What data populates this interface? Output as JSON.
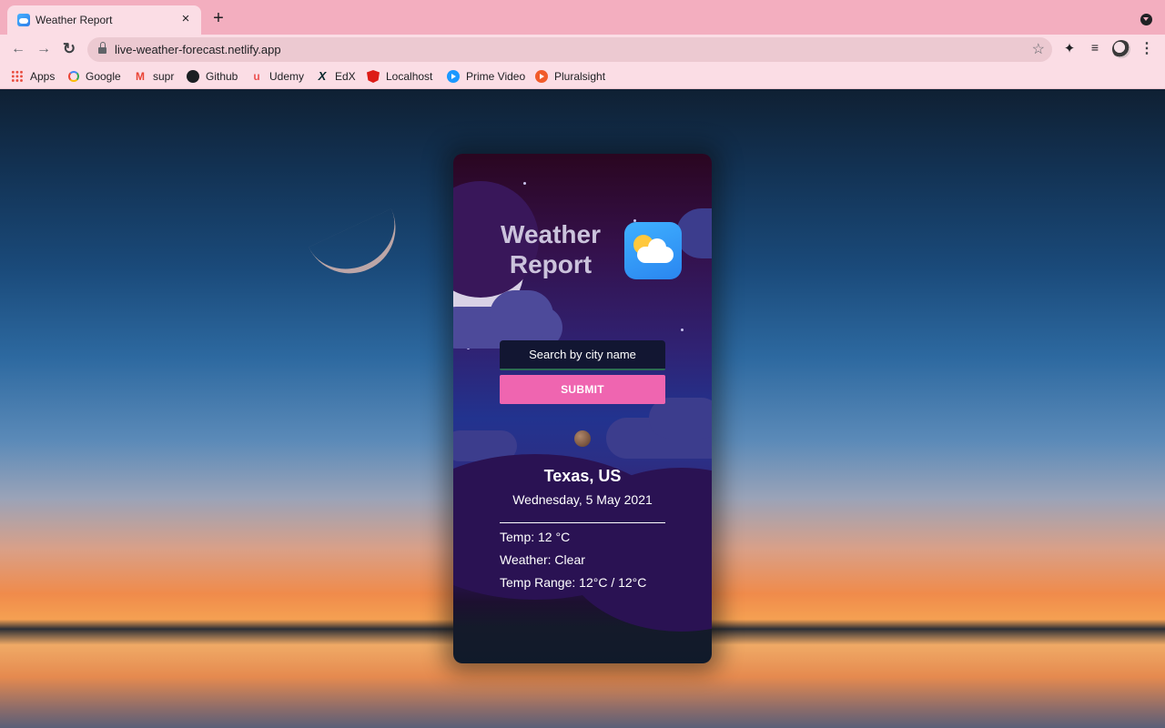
{
  "browser": {
    "tab_title": "Weather Report",
    "tab_close_glyph": "×",
    "new_tab_glyph": "+",
    "url": "live-weather-forecast.netlify.app",
    "nav": {
      "back_glyph": "←",
      "forward_glyph": "→",
      "reload_glyph": "↻"
    },
    "star_glyph": "☆",
    "menu_glyph": "⋮",
    "bookmarks": [
      {
        "label": "Apps",
        "icon": "apps-grid-icon"
      },
      {
        "label": "Google",
        "icon": "google-icon"
      },
      {
        "label": "supr",
        "icon": "gmail-icon"
      },
      {
        "label": "Github",
        "icon": "github-icon"
      },
      {
        "label": "Udemy",
        "icon": "udemy-icon"
      },
      {
        "label": "EdX",
        "icon": "edx-icon"
      },
      {
        "label": "Localhost",
        "icon": "angular-icon"
      },
      {
        "label": "Prime Video",
        "icon": "prime-video-icon"
      },
      {
        "label": "Pluralsight",
        "icon": "pluralsight-icon"
      }
    ]
  },
  "app": {
    "title": "Weather Report",
    "logo_icon": "sun-cloud-icon",
    "search": {
      "placeholder": "Search by city name",
      "value": ""
    },
    "submit_label": "SUBMIT",
    "weather_icon": "weather-condition-icon",
    "location": "Texas, US",
    "date": "Wednesday, 5 May 2021",
    "temp": "Temp: 12 °C",
    "condition": "Weather: Clear",
    "temp_range": "Temp Range: 12°C / 12°C"
  },
  "colors": {
    "chrome_tabstrip": "#f3aebf",
    "chrome_toolbar": "#fbdde5",
    "submit_button": "#ef65b0",
    "input_background": "#121632"
  }
}
